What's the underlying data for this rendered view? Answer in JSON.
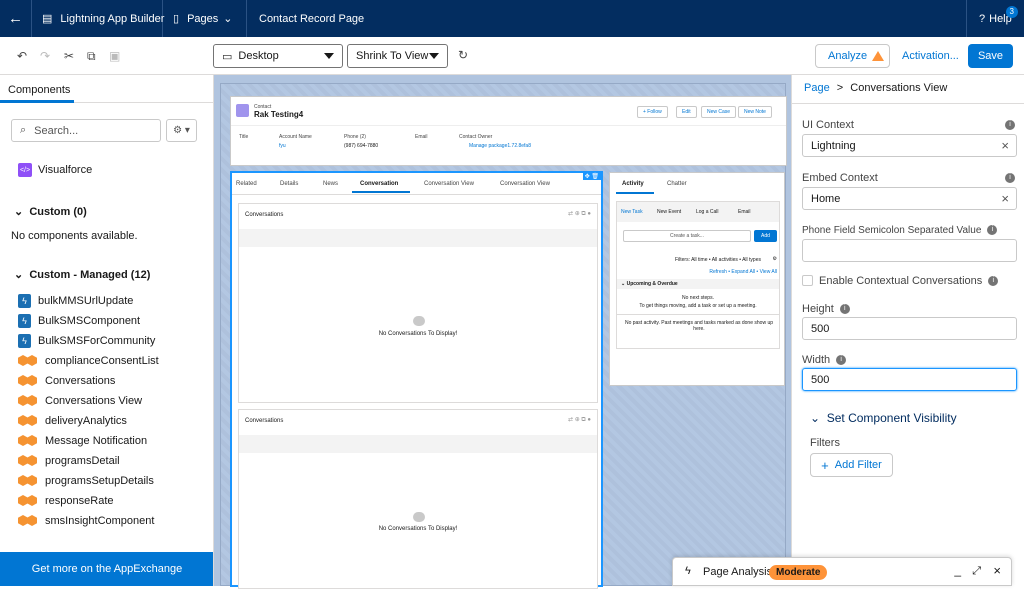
{
  "topbar": {
    "app_builder": "Lightning App Builder",
    "pages": "Pages",
    "page_name": "Contact Record Page",
    "help": "Help",
    "help_badge": "3"
  },
  "toolbar": {
    "device": "Desktop",
    "view": "Shrink To View",
    "analyze": "Analyze",
    "activation": "Activation...",
    "save": "Save"
  },
  "left": {
    "tab": "Components",
    "search_placeholder": "Search...",
    "visualforce": "Visualforce",
    "custom_header": "Custom (0)",
    "no_components": "No components available.",
    "managed_header": "Custom - Managed (12)",
    "managed": [
      "bulkMMSUrlUpdate",
      "BulkSMSComponent",
      "BulkSMSForCommunity",
      "complianceConsentList",
      "Conversations",
      "Conversations View",
      "deliveryAnalytics",
      "Message Notification",
      "programsDetail",
      "programsSetupDetails",
      "responseRate",
      "smsInsightComponent"
    ],
    "appexchange": "Get more on the AppExchange"
  },
  "canvas": {
    "record_type": "Contact",
    "record_name": "Rak Testing4",
    "actions": [
      "+ Follow",
      "Edit",
      "New Case",
      "New Note"
    ],
    "fields": [
      {
        "label": "Title",
        "value": ""
      },
      {
        "label": "Account Name",
        "value": "fyu"
      },
      {
        "label": "Phone (2)",
        "value": "(987) 694-7880"
      },
      {
        "label": "Email",
        "value": ""
      },
      {
        "label": "Contact Owner",
        "value": "Manage package1.72.8efa8"
      }
    ],
    "tabs": [
      "Related",
      "Details",
      "News",
      "Conversation",
      "Conversation View",
      "Conversation View"
    ],
    "conv_title": "Conversations",
    "no_conv": "No Conversations To Display!",
    "side_tabs": [
      "Activity",
      "Chatter"
    ],
    "activity_tabs": [
      "New Task",
      "New Event",
      "Log a Call",
      "Email"
    ],
    "create_task": "Create a task...",
    "add": "Add",
    "filters": "Filters: All time • All activities • All types",
    "links": "Refresh • Expand All • View All",
    "upcoming": "Upcoming & Overdue",
    "no_steps": "No next steps.",
    "no_steps_2": "To get things moving, add a task or set up a meeting.",
    "no_past": "No past activity. Past meetings and tasks marked as done show up here."
  },
  "right": {
    "breadcrumb_page": "Page",
    "breadcrumb_sep": ">",
    "breadcrumb_current": "Conversations View",
    "ui_context_label": "UI Context",
    "ui_context": "Lightning",
    "embed_label": "Embed Context",
    "embed": "Home",
    "phone_label": "Phone Field Semicolon Separated Value",
    "contextual_label": "Enable Contextual Conversations",
    "height_label": "Height",
    "height": "500",
    "width_label": "Width",
    "width": "500",
    "visibility": "Set Component Visibility",
    "filters": "Filters",
    "add_filter": "Add Filter"
  },
  "analysis": {
    "title": "Page Analysis",
    "status": "Moderate"
  }
}
